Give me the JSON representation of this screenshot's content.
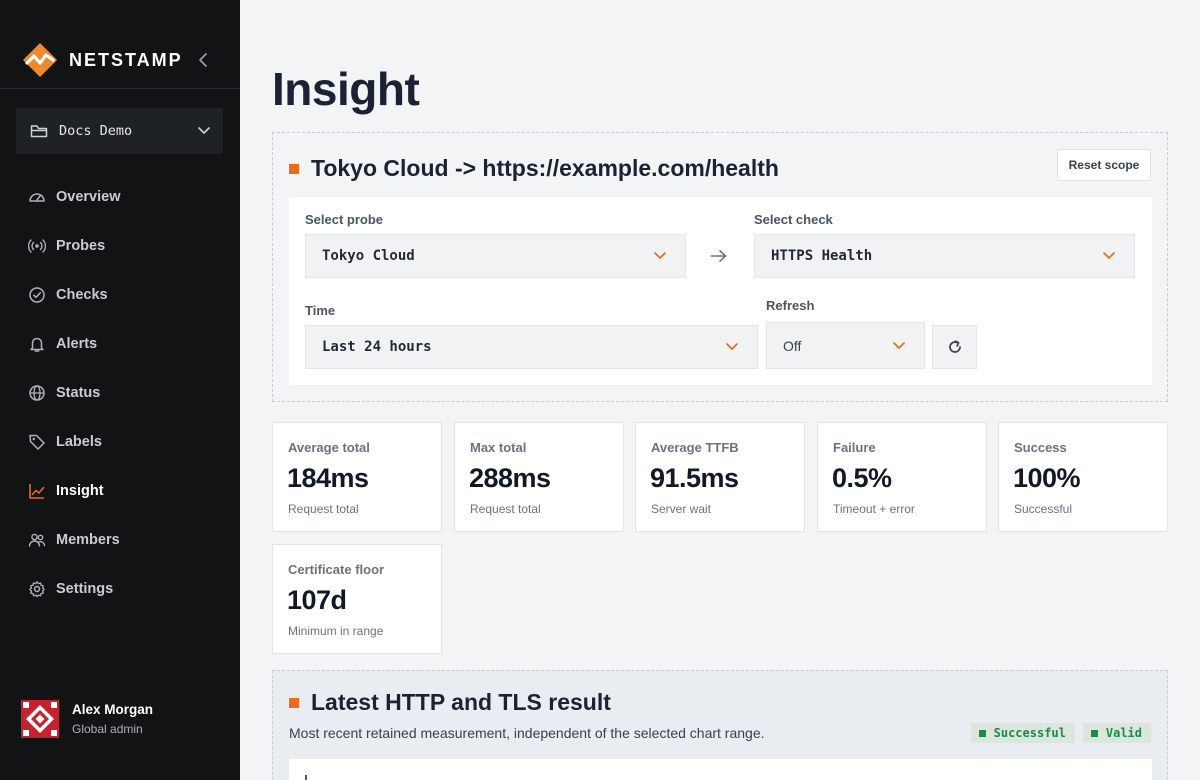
{
  "brand": {
    "name": "NETSTAMP",
    "accent": "#ea6a1e"
  },
  "workspace": {
    "name": "Docs Demo"
  },
  "nav": {
    "items": [
      {
        "label": "Overview",
        "icon": "gauge-icon"
      },
      {
        "label": "Probes",
        "icon": "broadcast-icon"
      },
      {
        "label": "Checks",
        "icon": "check-circle-icon"
      },
      {
        "label": "Alerts",
        "icon": "bell-icon"
      },
      {
        "label": "Status",
        "icon": "globe-icon"
      },
      {
        "label": "Labels",
        "icon": "tag-icon"
      },
      {
        "label": "Insight",
        "icon": "chart-icon",
        "active": true
      },
      {
        "label": "Members",
        "icon": "users-icon"
      },
      {
        "label": "Settings",
        "icon": "gear-icon"
      }
    ]
  },
  "user": {
    "name": "Alex Morgan",
    "role": "Global admin"
  },
  "page": {
    "title": "Insight"
  },
  "scope": {
    "title": "Tokyo Cloud -> https://example.com/health",
    "reset_label": "Reset scope",
    "probe_label": "Select probe",
    "probe_value": "Tokyo Cloud",
    "check_label": "Select check",
    "check_value": "HTTPS Health",
    "time_label": "Time",
    "time_value": "Last 24 hours",
    "refresh_label": "Refresh",
    "refresh_value": "Off"
  },
  "metrics": [
    {
      "label": "Average total",
      "value": "184ms",
      "sub": "Request total"
    },
    {
      "label": "Max total",
      "value": "288ms",
      "sub": "Request total"
    },
    {
      "label": "Average TTFB",
      "value": "91.5ms",
      "sub": "Server wait"
    },
    {
      "label": "Failure",
      "value": "0.5%",
      "sub": "Timeout + error"
    },
    {
      "label": "Success",
      "value": "100%",
      "sub": "Successful"
    },
    {
      "label": "Certificate floor",
      "value": "107d",
      "sub": "Minimum in range"
    }
  ],
  "latest": {
    "title": "Latest HTTP and TLS result",
    "description": "Most recent retained measurement, independent of the selected chart range.",
    "badges": [
      "Successful",
      "Valid"
    ],
    "badge_color": "#1f8a4c"
  }
}
